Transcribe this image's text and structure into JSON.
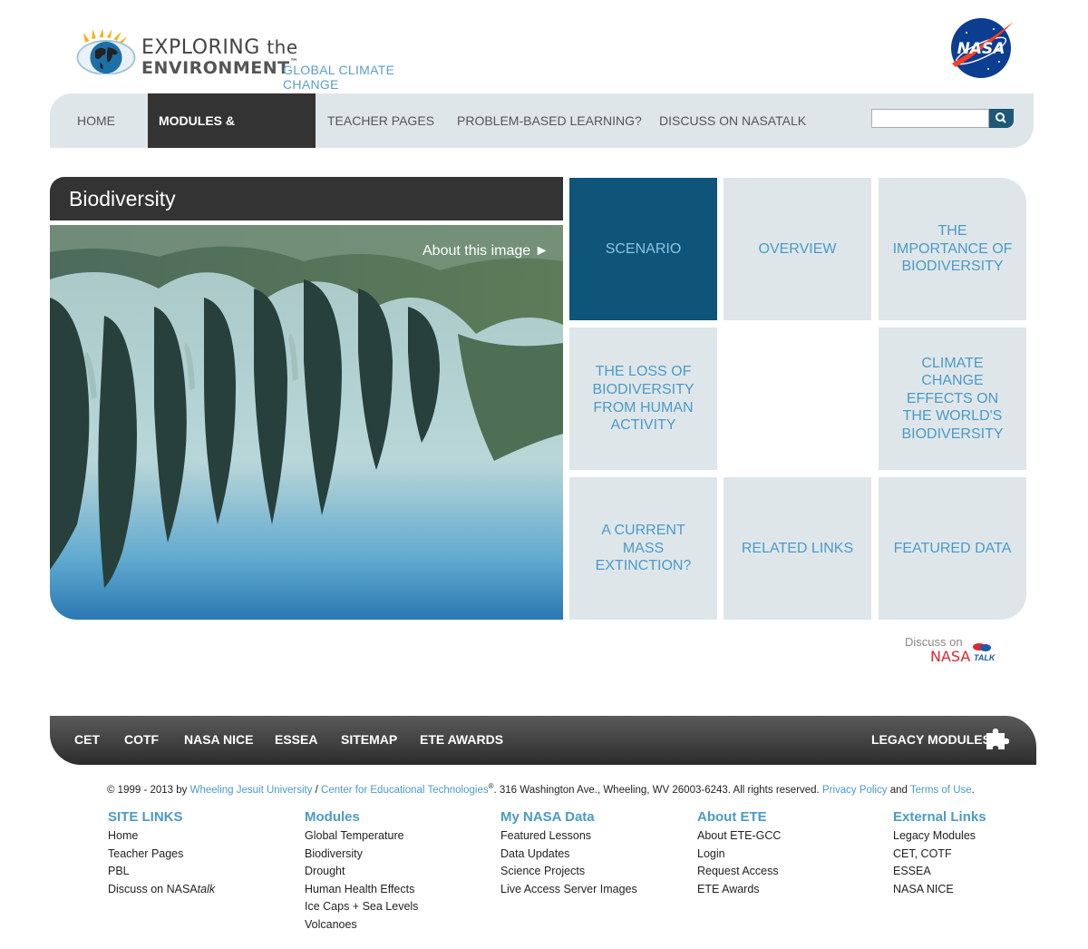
{
  "header": {
    "logo_line1_a": "EXPLORING",
    "logo_line1_b": "the",
    "logo_line2": "ENVIRONMENT",
    "logo_tm": "™",
    "logo_sub": "GLOBAL CLIMATE CHANGE",
    "nasa_logo_text": "NASA"
  },
  "nav": {
    "items": [
      {
        "label": "HOME"
      },
      {
        "label": "MODULES & ACTIVITIES",
        "active": true
      },
      {
        "label": "TEACHER PAGES"
      },
      {
        "label": "PROBLEM-BASED LEARNING?"
      },
      {
        "label": "DISCUSS ON NASATALK"
      }
    ],
    "search_value": ""
  },
  "page": {
    "title": "Biodiversity",
    "about_image": "About this image ►"
  },
  "tiles": [
    {
      "label": "SCENARIO",
      "active": true
    },
    {
      "label": "OVERVIEW"
    },
    {
      "label": "THE IMPORTANCE OF BIODIVERSITY"
    },
    {
      "label": "THE LOSS OF BIODIVERSITY FROM HUMAN ACTIVITY"
    },
    {
      "label": ""
    },
    {
      "label": "CLIMATE CHANGE EFFECTS ON THE WORLD'S BIODIVERSITY"
    },
    {
      "label": "A CURRENT MASS EXTINCTION?"
    },
    {
      "label": "RELATED LINKS"
    },
    {
      "label": "FEATURED DATA"
    }
  ],
  "discuss": {
    "label": "Discuss on",
    "nasa": "NASA",
    "talk": "TALK"
  },
  "footer_bar": {
    "items": [
      "CET",
      "COTF",
      "NASA NICE",
      "ESSEA",
      "SITEMAP",
      "ETE AWARDS"
    ],
    "legacy": "LEGACY MODULES"
  },
  "copyright": {
    "prefix": "© 1999 - 2013 by ",
    "wju": "Wheeling Jesuit University",
    "slash": " / ",
    "cet": "Center for Educational Technologies",
    "reg": "®",
    "address": ". 316 Washington Ave., Wheeling, WV 26003-6243. All rights reserved. ",
    "privacy": "Privacy Policy",
    "and": " and ",
    "terms": "Terms of Use",
    "end": "."
  },
  "footer_cols": [
    {
      "heading": "SITE LINKS",
      "items": [
        "Home",
        "Teacher Pages",
        "PBL",
        "Discuss on NASA"
      ]
    },
    {
      "heading": "Modules",
      "items": [
        "Global Temperature",
        "Biodiversity",
        "Drought",
        "Human Health Effects",
        "Ice Caps + Sea Levels",
        "Volcanoes"
      ]
    },
    {
      "heading": "My NASA Data",
      "items": [
        "Featured Lessons",
        "Data Updates",
        "Science Projects",
        "Live Access Server Images"
      ]
    },
    {
      "heading": "About ETE",
      "items": [
        "About ETE-GCC",
        "Login",
        "Request Access",
        "ETE Awards"
      ]
    },
    {
      "heading": "External Links",
      "items": [
        "Legacy Modules",
        "CET, COTF",
        "ESSEA",
        "NASA NICE"
      ]
    }
  ],
  "footer_extra": {
    "talk_italic": "talk"
  }
}
